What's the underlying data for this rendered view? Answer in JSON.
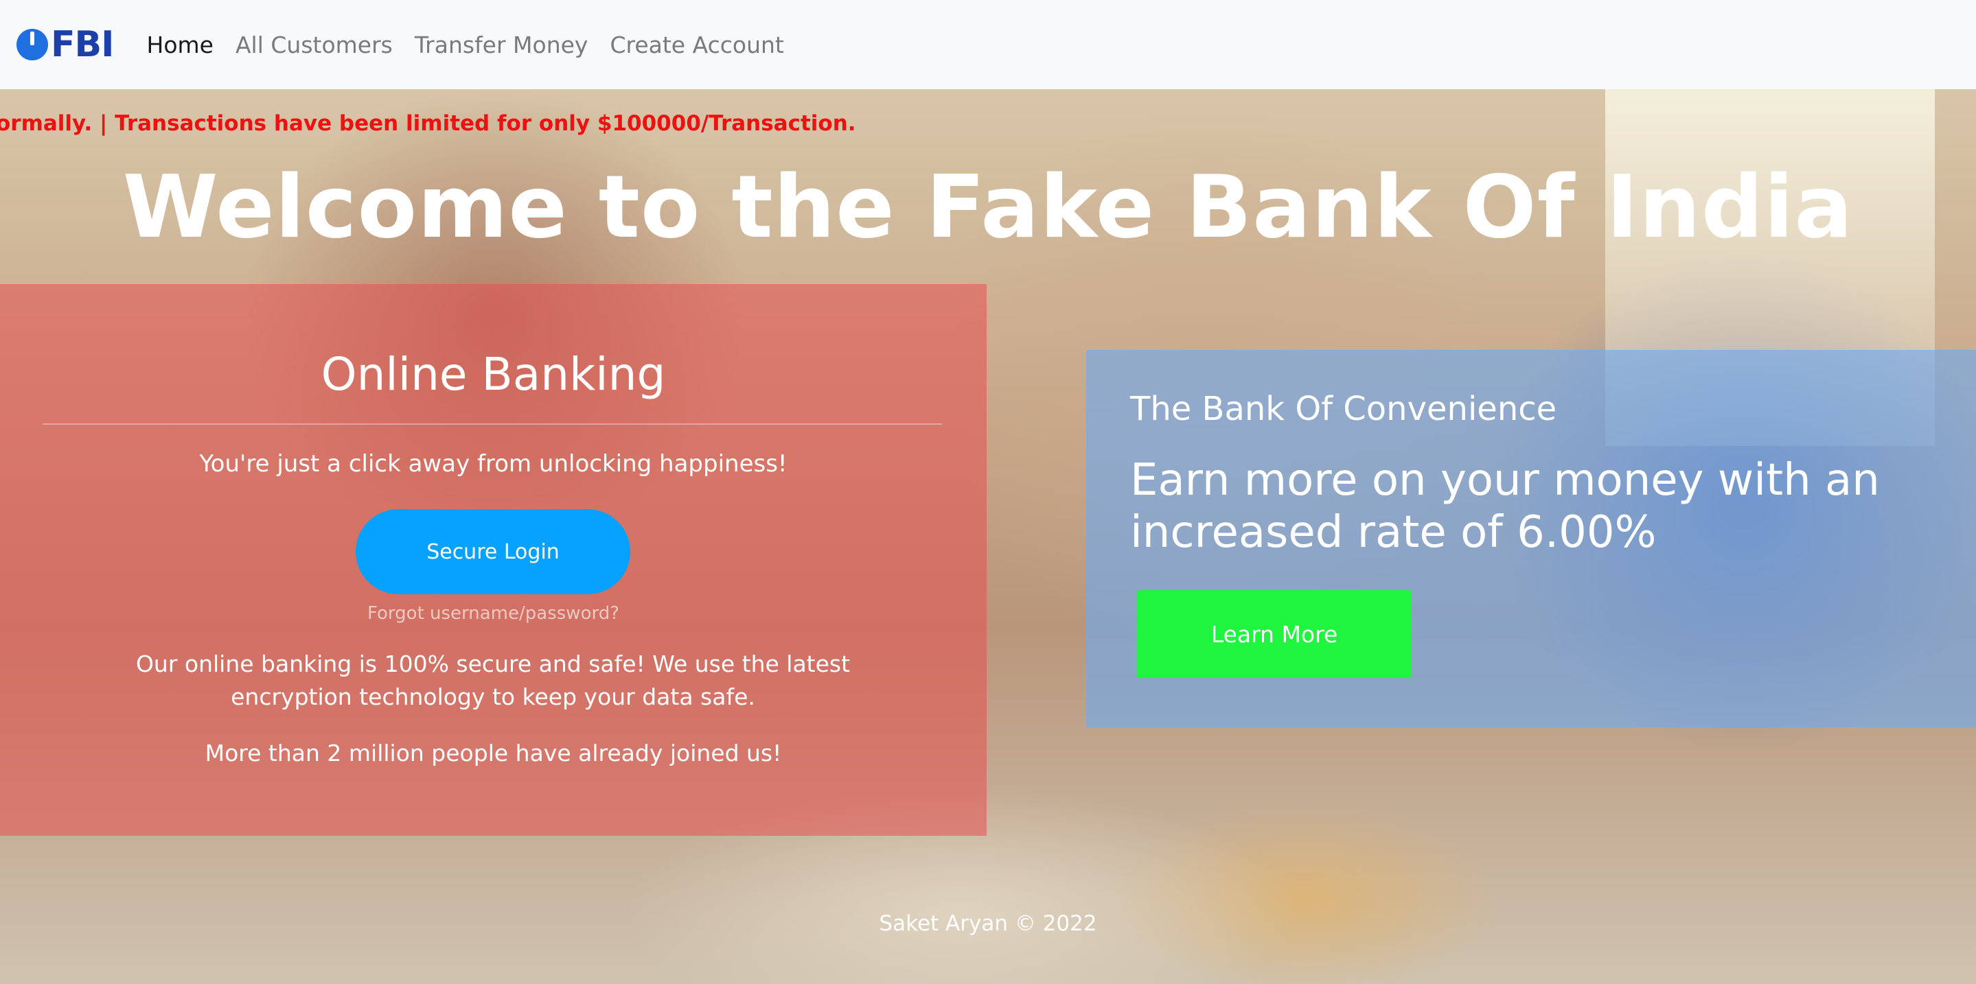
{
  "nav": {
    "brand": "FBI",
    "links": [
      "Home",
      "All Customers",
      "Transfer Money",
      "Create Account"
    ],
    "active": "Home"
  },
  "ticker": {
    "text": "ormally.   |   Transactions have been limited for only $100000/Transaction."
  },
  "hero": {
    "welcome": "Welcome to the Fake Bank Of India"
  },
  "online_banking": {
    "title": "Online Banking",
    "tagline": "You're just a click away from unlocking happiness!",
    "login_label": "Secure Login",
    "forgot_label": "Forgot username/password?",
    "secure_text": "Our online banking is 100% secure and safe! We use the latest encryption technology to keep your data safe.",
    "joined_text": "More than 2 million people have already joined us!"
  },
  "convenience": {
    "subtitle": "The Bank Of Convenience",
    "headline": "Earn more on your money with an increased rate of 6.00%",
    "learn_label": "Learn More"
  },
  "footer": {
    "text": "Saket Aryan © 2022"
  },
  "colors": {
    "brand": "#1c3fa8",
    "ticker": "#ee1111",
    "login_button": "#07a1ff",
    "learn_button": "#1ff53e"
  },
  "icons": {
    "brand_logo": "power-dial-icon"
  }
}
